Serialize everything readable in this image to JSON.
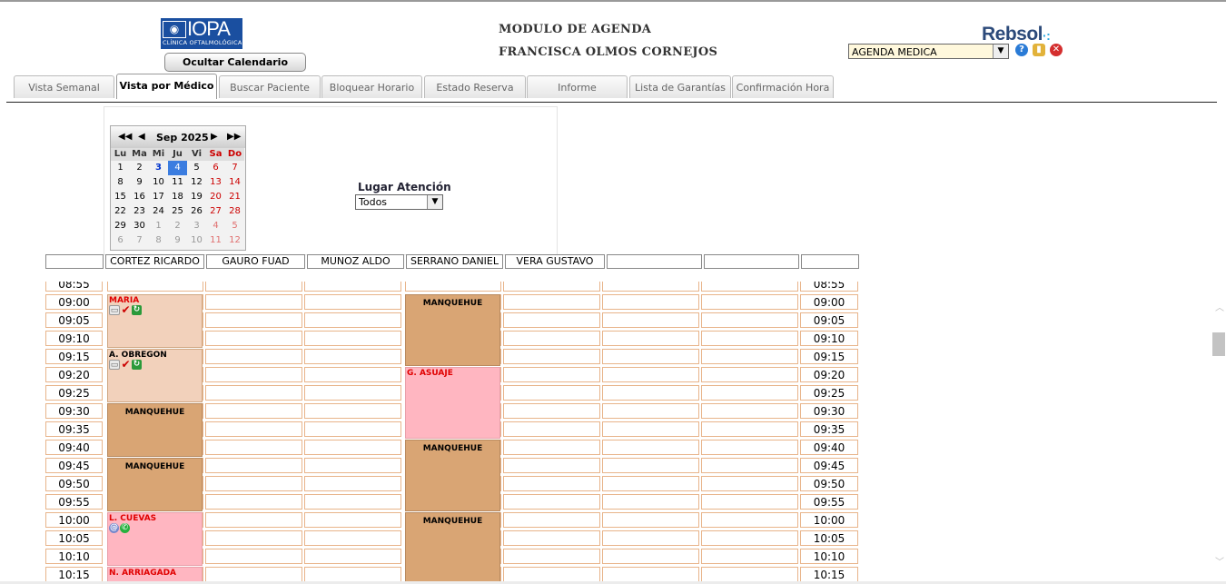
{
  "header": {
    "logo_text": "IOPA",
    "logo_sub": "CLÍNICA OFTALMOLÓGICA",
    "hide_calendar_button": "Ocultar Calendario",
    "title": "MODULO DE AGENDA",
    "user_name": "FRANCISCA OLMOS CORNEJOS",
    "brand": "Rebsol",
    "module_select_value": "AGENDA MEDICA"
  },
  "tabs": [
    {
      "label": "Vista Semanal",
      "active": false
    },
    {
      "label": "Vista por Médico",
      "active": true
    },
    {
      "label": "Buscar Paciente",
      "active": false
    },
    {
      "label": "Bloquear Horario",
      "active": false
    },
    {
      "label": "Estado Reserva",
      "active": false
    },
    {
      "label": "Informe",
      "active": false
    },
    {
      "label": "Lista de Garantías",
      "active": false
    },
    {
      "label": "Confirmación Hora",
      "active": false
    }
  ],
  "calendar": {
    "month_label": "Sep 2025",
    "weekdays": [
      "Lu",
      "Ma",
      "Mi",
      "Ju",
      "Vi",
      "Sa",
      "Do"
    ],
    "weeks": [
      [
        "1",
        "2",
        "3",
        "4",
        "5",
        "6",
        "7"
      ],
      [
        "8",
        "9",
        "10",
        "11",
        "12",
        "13",
        "14"
      ],
      [
        "15",
        "16",
        "17",
        "18",
        "19",
        "20",
        "21"
      ],
      [
        "22",
        "23",
        "24",
        "25",
        "26",
        "27",
        "28"
      ],
      [
        "29",
        "30",
        "1",
        "2",
        "3",
        "4",
        "5"
      ],
      [
        "6",
        "7",
        "8",
        "9",
        "10",
        "11",
        "12"
      ]
    ],
    "today": "3",
    "selected": "4"
  },
  "filter": {
    "label": "Lugar Atención",
    "value": "Todos"
  },
  "doctors": [
    "CORTEZ RICARDO",
    "GAURO FUAD",
    "MUNOZ ALDO",
    "SERRANO DANIEL",
    "VERA GUSTAVO",
    "",
    "",
    ""
  ],
  "times": [
    "08:55",
    "09:00",
    "09:05",
    "09:10",
    "09:15",
    "09:20",
    "09:25",
    "09:30",
    "09:35",
    "09:40",
    "09:45",
    "09:50",
    "09:55",
    "10:00",
    "10:05",
    "10:10",
    "10:15"
  ],
  "appointments": [
    {
      "col": 0,
      "start": 1,
      "span": 3,
      "label": "MARIA",
      "style": "peach",
      "label_color": "red",
      "icons": [
        "msg-icon",
        "check-icon",
        "refresh-icon"
      ]
    },
    {
      "col": 0,
      "start": 4,
      "span": 3,
      "label": "A. OBREGON",
      "style": "peach",
      "label_color": "black",
      "icons": [
        "msg-icon",
        "check-icon",
        "refresh-icon"
      ]
    },
    {
      "col": 0,
      "start": 7,
      "span": 3,
      "label": "MANQUEHUE",
      "style": "tan",
      "label_color": "black",
      "icons": []
    },
    {
      "col": 0,
      "start": 10,
      "span": 3,
      "label": "MANQUEHUE",
      "style": "tan",
      "label_color": "black",
      "icons": []
    },
    {
      "col": 0,
      "start": 13,
      "span": 3,
      "label": "L. CUEVAS",
      "style": "pink",
      "label_color": "red",
      "icons": [
        "mail-icon",
        "whatsapp-icon"
      ]
    },
    {
      "col": 0,
      "start": 16,
      "span": 1,
      "label": "N. ARRIAGADA",
      "style": "pink",
      "label_color": "red",
      "icons": []
    },
    {
      "col": 3,
      "start": 1,
      "span": 4,
      "label": "MANQUEHUE",
      "style": "tan",
      "label_color": "black",
      "icons": []
    },
    {
      "col": 3,
      "start": 5,
      "span": 4,
      "label": "G. ASUAJE",
      "style": "pink",
      "label_color": "red",
      "icons": []
    },
    {
      "col": 3,
      "start": 9,
      "span": 4,
      "label": "MANQUEHUE",
      "style": "tan",
      "label_color": "black",
      "icons": []
    },
    {
      "col": 3,
      "start": 13,
      "span": 4,
      "label": "MANQUEHUE",
      "style": "tan",
      "label_color": "black",
      "icons": []
    }
  ]
}
